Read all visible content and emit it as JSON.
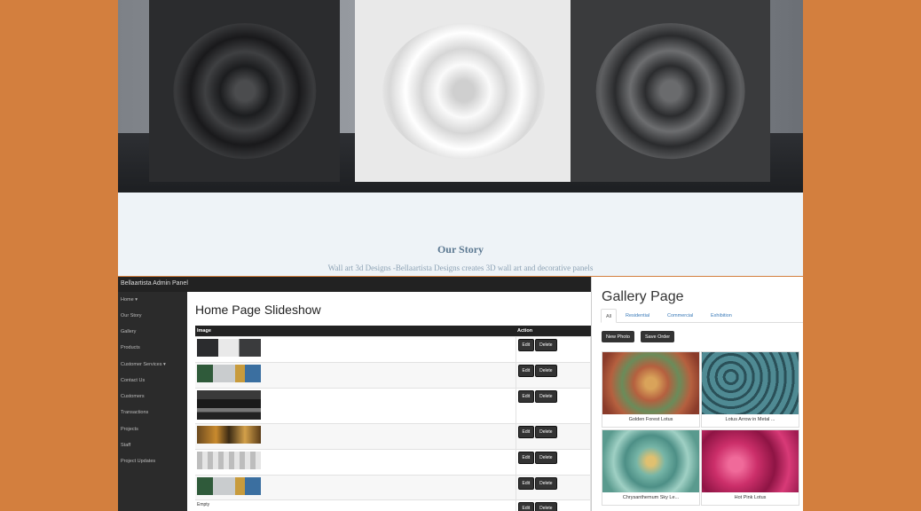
{
  "site": {
    "our_story": "Our Story",
    "subtitle": "Wall art 3d Designs -Bellaartista Designs creates 3D wall art and decorative panels"
  },
  "admin": {
    "title": "Bellaartista Admin Panel",
    "nav": [
      "Home ▾",
      "Our Story",
      "Gallery",
      "Products",
      "Customer Services ▾",
      "Contact Us",
      "Customers",
      "Transactions",
      "Projects",
      "Staff",
      "Project Updates"
    ],
    "page_title": "Home Page Slideshow",
    "columns": [
      "Image",
      "Action"
    ],
    "edit_label": "Edit",
    "delete_label": "Delete",
    "empty_label": "Empty"
  },
  "gallery": {
    "title": "Gallery Page",
    "tabs": [
      "All",
      "Residential",
      "Commercial",
      "Exhibition"
    ],
    "new_photo": "New Photo",
    "save_order": "Save Order",
    "items": [
      {
        "caption": "Golden Forest Lotus",
        "color": "#b5603f"
      },
      {
        "caption": "Lotus Arrow in Metal ...",
        "color": "#4f8a93"
      },
      {
        "caption": "Chrysanthemum Sky Le...",
        "color": "#76b5a7"
      },
      {
        "caption": "Hot Pink Lotus",
        "color": "#cc2f6a"
      }
    ]
  },
  "colors": {
    "background": "#d37f3e",
    "admin_bar": "#222222",
    "link": "#3a7ab8"
  }
}
